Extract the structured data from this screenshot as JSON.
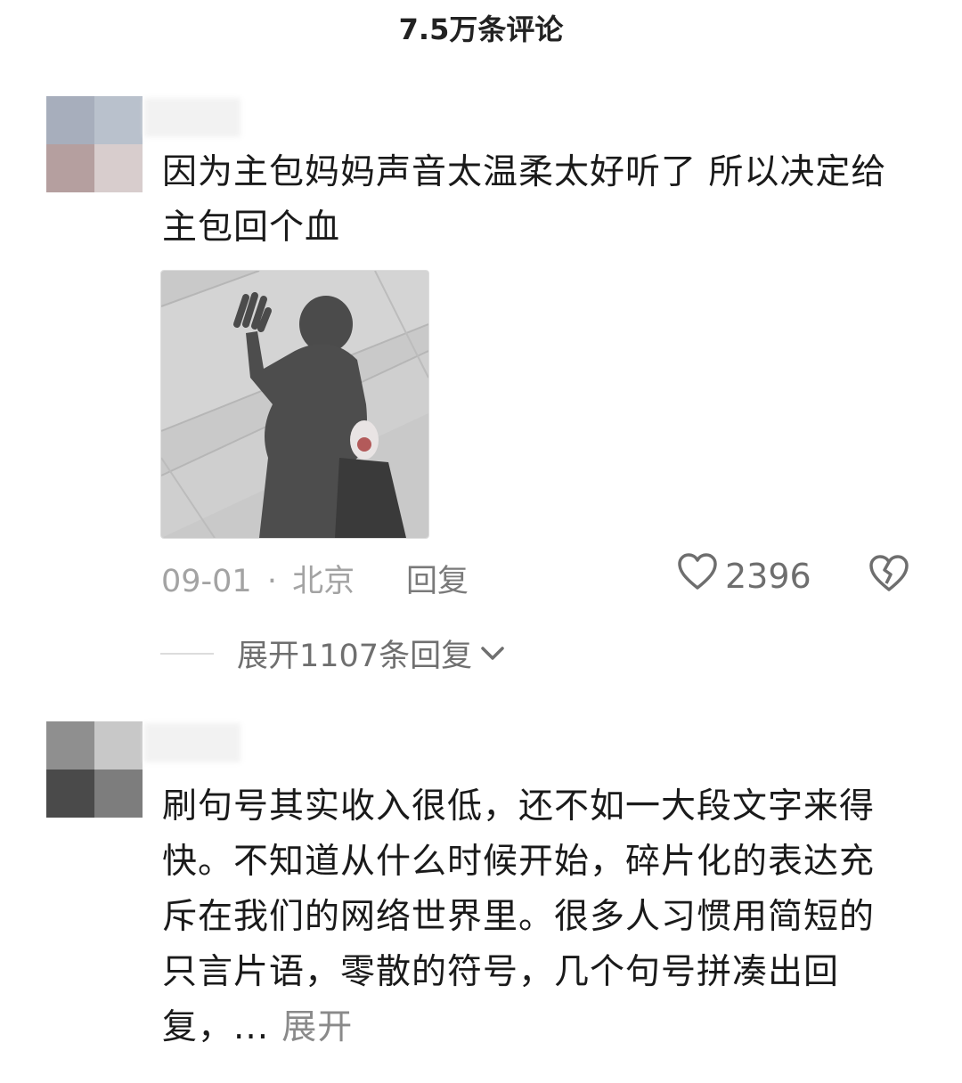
{
  "header": {
    "title": "7.5万条评论"
  },
  "comments": [
    {
      "text": "因为主包妈妈声音太温柔太好听了 所以决定给主包回个血",
      "date": "09-01",
      "location": "北京",
      "separator": "·",
      "reply_label": "回复",
      "like_count": "2396",
      "expand_replies": "展开1107条回复"
    },
    {
      "text": "刷句号其实收入很低，还不如一大段文字来得快。不知道从什么时候开始，碎片化的表达充斥在我们的网络世界里。很多人习惯用简短的只言片语，零散的符号，几个句号拼凑出回复，...",
      "expand_label": "展开"
    }
  ],
  "colors": {
    "accent_text": "#1a1a1a",
    "muted": "#a3a3a3",
    "icon": "#6e6e6e"
  },
  "icons": [
    "heart-outline-icon",
    "broken-heart-icon",
    "chevron-down-icon"
  ]
}
